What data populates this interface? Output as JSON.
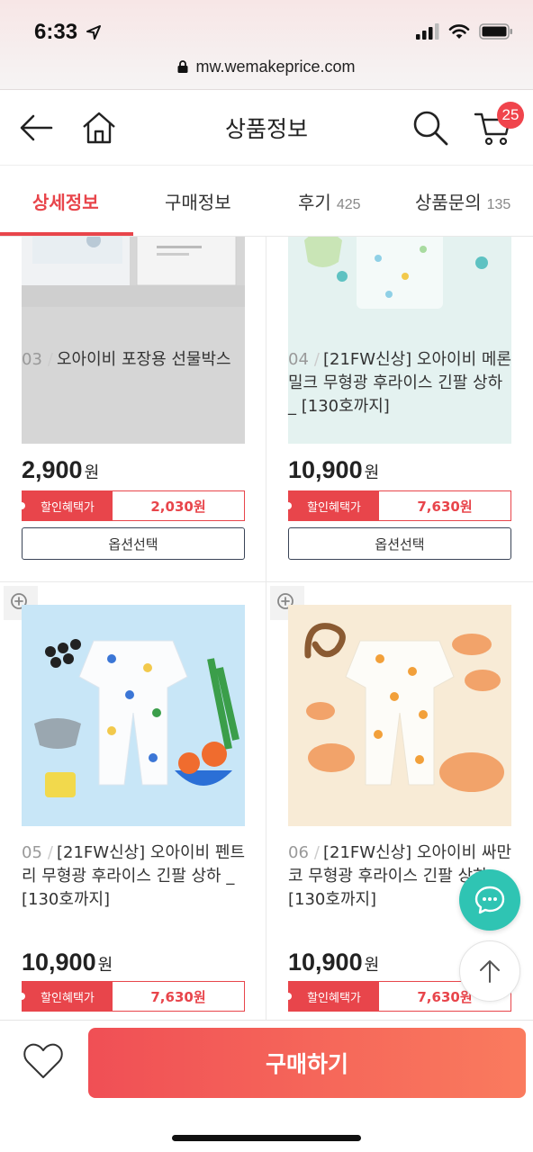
{
  "status_bar": {
    "time": "6:33"
  },
  "browser": {
    "url": "mw.wemakeprice.com"
  },
  "header": {
    "title": "상품정보",
    "cart_count": "25"
  },
  "tabs": [
    {
      "label": "상세정보",
      "count": "",
      "active": true
    },
    {
      "label": "구매정보",
      "count": ""
    },
    {
      "label": "후기",
      "count": "425"
    },
    {
      "label": "상품문의",
      "count": "135"
    }
  ],
  "products": [
    {
      "num": "03",
      "name": "오아이비 포장용 선물박스",
      "price": "2,900",
      "unit": "원",
      "discount_label": "할인혜택가",
      "discount_price": "2,030원",
      "option_label": "옵션선택"
    },
    {
      "num": "04",
      "name": "[21FW신상] 오아이비 메론밀크 무형광 후라이스 긴팔 상하 _ [130호까지]",
      "price": "10,900",
      "unit": "원",
      "discount_label": "할인혜택가",
      "discount_price": "7,630원",
      "option_label": "옵션선택"
    },
    {
      "num": "05",
      "name": "[21FW신상] 오아이비 펜트리 무형광 후라이스 긴팔 상하 _ [130호까지]",
      "price": "10,900",
      "unit": "원",
      "discount_label": "할인혜택가",
      "discount_price": "7,630원"
    },
    {
      "num": "06",
      "name": "[21FW신상] 오아이비 싸만코 무형광 후라이스 긴팔 상하 _ [130호까지]",
      "price": "10,900",
      "unit": "원",
      "discount_label": "할인혜택가",
      "discount_price": "7,630원"
    }
  ],
  "bottom": {
    "buy_label": "구매하기"
  },
  "colors": {
    "accent": "#e8454b",
    "chat": "#2fc4b3",
    "navy": "#3a4457"
  }
}
